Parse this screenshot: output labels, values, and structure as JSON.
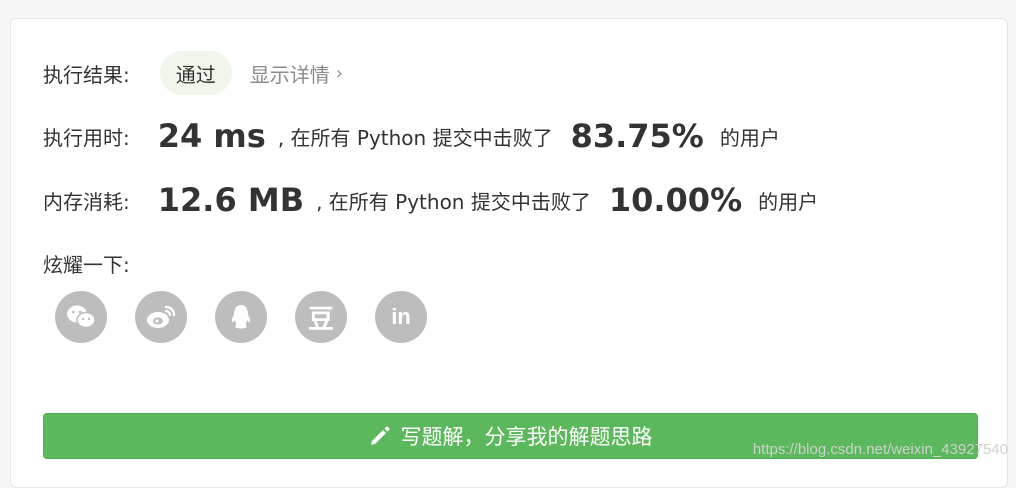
{
  "result": {
    "label": "执行结果:",
    "status": "通过",
    "detail_link": "显示详情",
    "detail_chevron": "›"
  },
  "runtime": {
    "label": "执行用时:",
    "value": "24 ms",
    "middle_text": ", 在所有 Python 提交中击败了",
    "percent": "83.75%",
    "suffix": "的用户"
  },
  "memory": {
    "label": "内存消耗:",
    "value": "12.6 MB",
    "middle_text": ", 在所有 Python 提交中击败了",
    "percent": "10.00%",
    "suffix": "的用户"
  },
  "share": {
    "label": "炫耀一下:",
    "buttons": [
      {
        "icon": "wechat-icon"
      },
      {
        "icon": "weibo-icon"
      },
      {
        "icon": "qq-icon"
      },
      {
        "icon": "douban-icon",
        "glyph": "豆"
      },
      {
        "icon": "linkedin-icon",
        "glyph": "in"
      }
    ]
  },
  "write_solution": {
    "label": "写题解，分享我的解题思路",
    "icon": "pencil-icon"
  },
  "watermark": "https://blog.csdn.net/weixin_43927540",
  "colors": {
    "accent_green": "#5cb85c",
    "pill_bg": "#f0f6ec",
    "icon_gray": "#bdbdbd",
    "muted_text": "#8c8c8c"
  }
}
